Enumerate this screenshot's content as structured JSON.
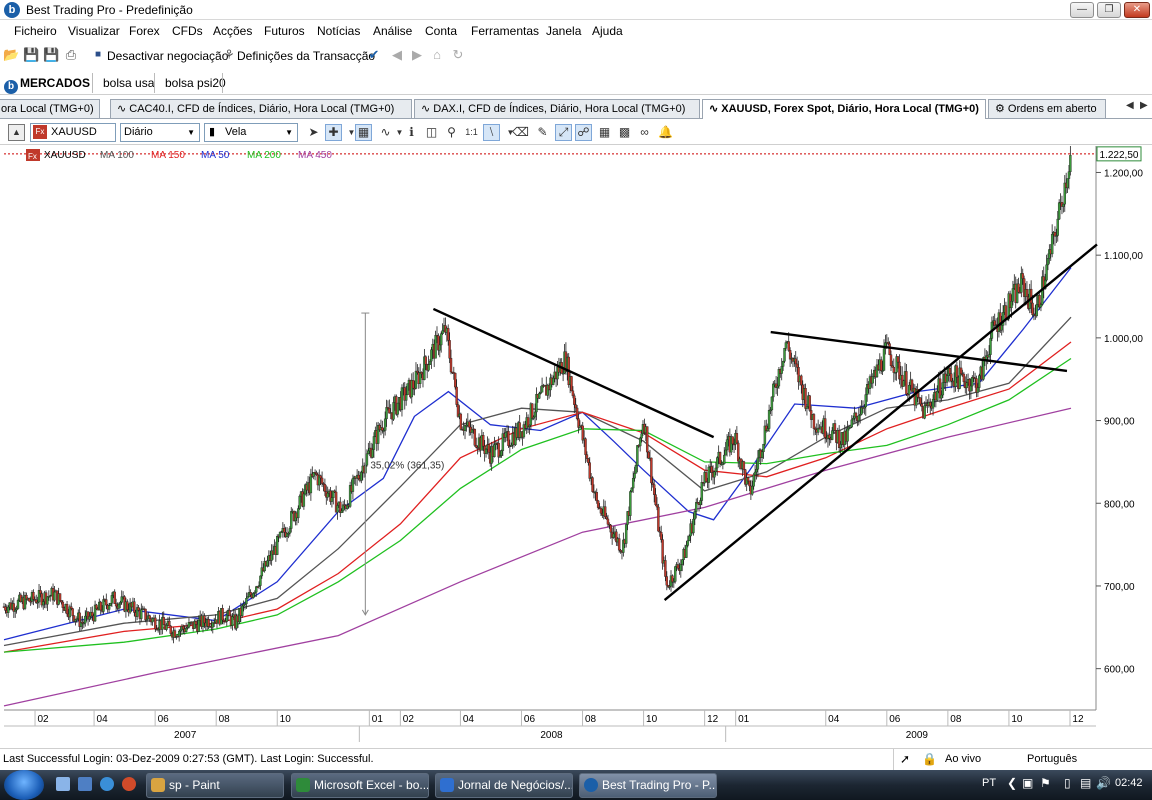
{
  "window": {
    "title": "Best Trading Pro - Predefinição",
    "icon": "b"
  },
  "menu": [
    "Ficheiro",
    "Visualizar",
    "Forex",
    "CFDs",
    "Acções",
    "Futuros",
    "Notícias",
    "Análise",
    "Conta",
    "Ferramentas",
    "Janela",
    "Ajuda"
  ],
  "toolbar": {
    "deactivate_label": "Desactivar negociação",
    "settings_label": "Definições da Transacção"
  },
  "workspace": {
    "home_label": "MERCADOS",
    "tabs": [
      "bolsa usa",
      "bolsa psi20"
    ]
  },
  "doc_tabs": [
    {
      "label": "ora Local (TMG+0)",
      "active": false
    },
    {
      "label": "CAC40.I, CFD de Índices, Diário, Hora Local (TMG+0)",
      "active": false
    },
    {
      "label": "DAX.I, CFD de Índices, Diário, Hora Local (TMG+0)",
      "active": false
    },
    {
      "label": "XAUUSD, Forex Spot, Diário, Hora Local (TMG+0)",
      "active": true
    },
    {
      "label": "Ordens em aberto",
      "active": false
    }
  ],
  "chart_toolbar": {
    "symbol": "XAUUSD",
    "period": "Diário",
    "chart_type": "Vela"
  },
  "chart_data": {
    "type": "line",
    "symbol_badge": "Fx",
    "legend": [
      {
        "label": "XAUUSD",
        "color": "#000000"
      },
      {
        "label": "MA 100",
        "color": "#555555"
      },
      {
        "label": "MA 150",
        "color": "#e02020"
      },
      {
        "label": "MA 50",
        "color": "#1f2fd0"
      },
      {
        "label": "MA 200",
        "color": "#20c020"
      },
      {
        "label": "MA 450",
        "color": "#a040a0"
      }
    ],
    "current_price_label": "1.222,50",
    "current_price": 1222.5,
    "ylim": [
      550,
      1232
    ],
    "y_ticks": [
      {
        "label": "1.200,00",
        "v": 1200
      },
      {
        "label": "1.100,00",
        "v": 1100
      },
      {
        "label": "1.000,00",
        "v": 1000
      },
      {
        "label": "900,00",
        "v": 900
      },
      {
        "label": "800,00",
        "v": 800
      },
      {
        "label": "700,00",
        "v": 700
      },
      {
        "label": "600,00",
        "v": 600
      }
    ],
    "x_range": [
      "2007-01-01",
      "2009-12-31"
    ],
    "month_ticks": [
      {
        "label": "02",
        "date": "2007-02-01"
      },
      {
        "label": "04",
        "date": "2007-04-01"
      },
      {
        "label": "06",
        "date": "2007-06-01"
      },
      {
        "label": "08",
        "date": "2007-08-01"
      },
      {
        "label": "10",
        "date": "2007-10-01"
      },
      {
        "label": "01",
        "date": "2008-01-01"
      },
      {
        "label": "02",
        "date": "2008-02-01"
      },
      {
        "label": "04",
        "date": "2008-04-01"
      },
      {
        "label": "06",
        "date": "2008-06-01"
      },
      {
        "label": "08",
        "date": "2008-08-01"
      },
      {
        "label": "10",
        "date": "2008-10-01"
      },
      {
        "label": "12",
        "date": "2008-12-01"
      },
      {
        "label": "01",
        "date": "2009-01-01"
      },
      {
        "label": "04",
        "date": "2009-04-01"
      },
      {
        "label": "06",
        "date": "2009-06-01"
      },
      {
        "label": "08",
        "date": "2009-08-01"
      },
      {
        "label": "10",
        "date": "2009-10-01"
      },
      {
        "label": "12",
        "date": "2009-12-01"
      }
    ],
    "year_ticks": [
      {
        "label": "2007",
        "date": "2007-07-01"
      },
      {
        "label": "2008",
        "date": "2008-07-01"
      },
      {
        "label": "2009",
        "date": "2009-07-01"
      }
    ],
    "price_anchors": [
      {
        "date": "2007-01-01",
        "v": 675
      },
      {
        "date": "2007-02-20",
        "v": 690
      },
      {
        "date": "2007-03-20",
        "v": 655
      },
      {
        "date": "2007-04-20",
        "v": 685
      },
      {
        "date": "2007-06-20",
        "v": 645
      },
      {
        "date": "2007-08-10",
        "v": 665
      },
      {
        "date": "2007-08-20",
        "v": 655
      },
      {
        "date": "2007-09-20",
        "v": 725
      },
      {
        "date": "2007-11-08",
        "v": 835
      },
      {
        "date": "2007-12-05",
        "v": 790
      },
      {
        "date": "2008-01-15",
        "v": 900
      },
      {
        "date": "2008-02-15",
        "v": 945
      },
      {
        "date": "2008-03-17",
        "v": 1010
      },
      {
        "date": "2008-04-01",
        "v": 900
      },
      {
        "date": "2008-05-01",
        "v": 860
      },
      {
        "date": "2008-06-01",
        "v": 890
      },
      {
        "date": "2008-07-15",
        "v": 975
      },
      {
        "date": "2008-08-15",
        "v": 800
      },
      {
        "date": "2008-09-10",
        "v": 745
      },
      {
        "date": "2008-10-01",
        "v": 905
      },
      {
        "date": "2008-10-24",
        "v": 700
      },
      {
        "date": "2008-11-10",
        "v": 735
      },
      {
        "date": "2008-11-28",
        "v": 820
      },
      {
        "date": "2008-12-31",
        "v": 880
      },
      {
        "date": "2009-01-15",
        "v": 810
      },
      {
        "date": "2009-02-20",
        "v": 995
      },
      {
        "date": "2009-03-20",
        "v": 900
      },
      {
        "date": "2009-04-20",
        "v": 875
      },
      {
        "date": "2009-06-01",
        "v": 985
      },
      {
        "date": "2009-07-08",
        "v": 910
      },
      {
        "date": "2009-08-01",
        "v": 955
      },
      {
        "date": "2009-09-01",
        "v": 945
      },
      {
        "date": "2009-09-15",
        "v": 1010
      },
      {
        "date": "2009-10-14",
        "v": 1065
      },
      {
        "date": "2009-10-28",
        "v": 1030
      },
      {
        "date": "2009-11-15",
        "v": 1120
      },
      {
        "date": "2009-12-02",
        "v": 1222.5
      }
    ],
    "moving_averages": [
      {
        "name": "MA 50",
        "color": "#1f2fd0",
        "points": [
          {
            "date": "2007-01-01",
            "v": 635
          },
          {
            "date": "2007-05-01",
            "v": 672
          },
          {
            "date": "2007-08-01",
            "v": 658
          },
          {
            "date": "2007-10-01",
            "v": 705
          },
          {
            "date": "2007-12-01",
            "v": 790
          },
          {
            "date": "2008-01-15",
            "v": 830
          },
          {
            "date": "2008-02-15",
            "v": 905
          },
          {
            "date": "2008-03-20",
            "v": 935
          },
          {
            "date": "2008-05-01",
            "v": 895
          },
          {
            "date": "2008-06-20",
            "v": 888
          },
          {
            "date": "2008-08-01",
            "v": 910
          },
          {
            "date": "2008-09-01",
            "v": 875
          },
          {
            "date": "2008-10-01",
            "v": 840
          },
          {
            "date": "2008-11-15",
            "v": 790
          },
          {
            "date": "2008-12-10",
            "v": 780
          },
          {
            "date": "2009-01-15",
            "v": 840
          },
          {
            "date": "2009-03-01",
            "v": 920
          },
          {
            "date": "2009-05-01",
            "v": 915
          },
          {
            "date": "2009-07-01",
            "v": 935
          },
          {
            "date": "2009-09-01",
            "v": 945
          },
          {
            "date": "2009-10-15",
            "v": 1010
          },
          {
            "date": "2009-12-02",
            "v": 1085
          }
        ]
      },
      {
        "name": "MA 100",
        "color": "#555555",
        "points": [
          {
            "date": "2007-01-01",
            "v": 628
          },
          {
            "date": "2007-05-01",
            "v": 655
          },
          {
            "date": "2007-08-01",
            "v": 665
          },
          {
            "date": "2007-10-01",
            "v": 685
          },
          {
            "date": "2007-12-01",
            "v": 745
          },
          {
            "date": "2008-02-01",
            "v": 820
          },
          {
            "date": "2008-04-01",
            "v": 895
          },
          {
            "date": "2008-06-01",
            "v": 915
          },
          {
            "date": "2008-08-01",
            "v": 910
          },
          {
            "date": "2008-10-01",
            "v": 875
          },
          {
            "date": "2008-12-01",
            "v": 815
          },
          {
            "date": "2009-02-01",
            "v": 838
          },
          {
            "date": "2009-04-01",
            "v": 880
          },
          {
            "date": "2009-06-01",
            "v": 915
          },
          {
            "date": "2009-08-01",
            "v": 925
          },
          {
            "date": "2009-10-01",
            "v": 945
          },
          {
            "date": "2009-12-02",
            "v": 1025
          }
        ]
      },
      {
        "name": "MA 150",
        "color": "#e02020",
        "points": [
          {
            "date": "2007-01-01",
            "v": 620
          },
          {
            "date": "2007-05-01",
            "v": 645
          },
          {
            "date": "2007-08-01",
            "v": 655
          },
          {
            "date": "2007-10-01",
            "v": 672
          },
          {
            "date": "2007-12-01",
            "v": 715
          },
          {
            "date": "2008-02-01",
            "v": 775
          },
          {
            "date": "2008-04-01",
            "v": 855
          },
          {
            "date": "2008-06-01",
            "v": 890
          },
          {
            "date": "2008-08-01",
            "v": 910
          },
          {
            "date": "2008-10-01",
            "v": 885
          },
          {
            "date": "2008-12-01",
            "v": 840
          },
          {
            "date": "2009-02-01",
            "v": 832
          },
          {
            "date": "2009-04-01",
            "v": 855
          },
          {
            "date": "2009-06-01",
            "v": 890
          },
          {
            "date": "2009-08-01",
            "v": 915
          },
          {
            "date": "2009-10-01",
            "v": 938
          },
          {
            "date": "2009-12-02",
            "v": 995
          }
        ]
      },
      {
        "name": "MA 200",
        "color": "#20c020",
        "points": [
          {
            "date": "2007-01-01",
            "v": 620
          },
          {
            "date": "2007-05-01",
            "v": 632
          },
          {
            "date": "2007-08-01",
            "v": 648
          },
          {
            "date": "2007-10-01",
            "v": 665
          },
          {
            "date": "2007-12-01",
            "v": 705
          },
          {
            "date": "2008-02-01",
            "v": 755
          },
          {
            "date": "2008-04-01",
            "v": 818
          },
          {
            "date": "2008-06-01",
            "v": 865
          },
          {
            "date": "2008-08-01",
            "v": 890
          },
          {
            "date": "2008-10-01",
            "v": 888
          },
          {
            "date": "2008-12-01",
            "v": 850
          },
          {
            "date": "2009-02-01",
            "v": 848
          },
          {
            "date": "2009-04-01",
            "v": 860
          },
          {
            "date": "2009-06-01",
            "v": 870
          },
          {
            "date": "2009-08-01",
            "v": 895
          },
          {
            "date": "2009-10-01",
            "v": 925
          },
          {
            "date": "2009-12-02",
            "v": 975
          }
        ]
      },
      {
        "name": "MA 450",
        "color": "#a040a0",
        "points": [
          {
            "date": "2007-01-01",
            "v": 555
          },
          {
            "date": "2007-06-01",
            "v": 595
          },
          {
            "date": "2007-12-01",
            "v": 640
          },
          {
            "date": "2008-04-01",
            "v": 705
          },
          {
            "date": "2008-08-01",
            "v": 765
          },
          {
            "date": "2008-12-01",
            "v": 795
          },
          {
            "date": "2009-04-01",
            "v": 840
          },
          {
            "date": "2009-08-01",
            "v": 880
          },
          {
            "date": "2009-12-02",
            "v": 915
          }
        ]
      }
    ],
    "trendlines": [
      {
        "from": {
          "date": "2008-03-05",
          "v": 1035
        },
        "to": {
          "date": "2008-12-10",
          "v": 880
        }
      },
      {
        "from": {
          "date": "2008-10-22",
          "v": 683
        },
        "to": {
          "date": "2009-12-28",
          "v": 1113
        }
      },
      {
        "from": {
          "date": "2009-02-05",
          "v": 1007
        },
        "to": {
          "date": "2009-11-28",
          "v": 960
        }
      }
    ],
    "measure": {
      "date": "2007-12-28",
      "from": 665,
      "to": 1030,
      "label": "35,02% (361,35)",
      "label_v": 842
    }
  },
  "status": {
    "left": "Last Successful Login: 03-Dez-2009 0:27:53 (GMT). Last Login: Successful.",
    "mode": "Ao vivo",
    "language": "Português"
  },
  "taskbar": {
    "tasks": [
      {
        "label": "sp - Paint",
        "color": "#d9a441"
      },
      {
        "label": "Microsoft Excel - bo...",
        "color": "#2e8b3a"
      },
      {
        "label": "Jornal de Negócios/...",
        "color": "#2f6fd0"
      },
      {
        "label": "Best Trading Pro - P...",
        "color": "#1b5fa8"
      }
    ],
    "lang": "PT",
    "clock": "02:42"
  }
}
